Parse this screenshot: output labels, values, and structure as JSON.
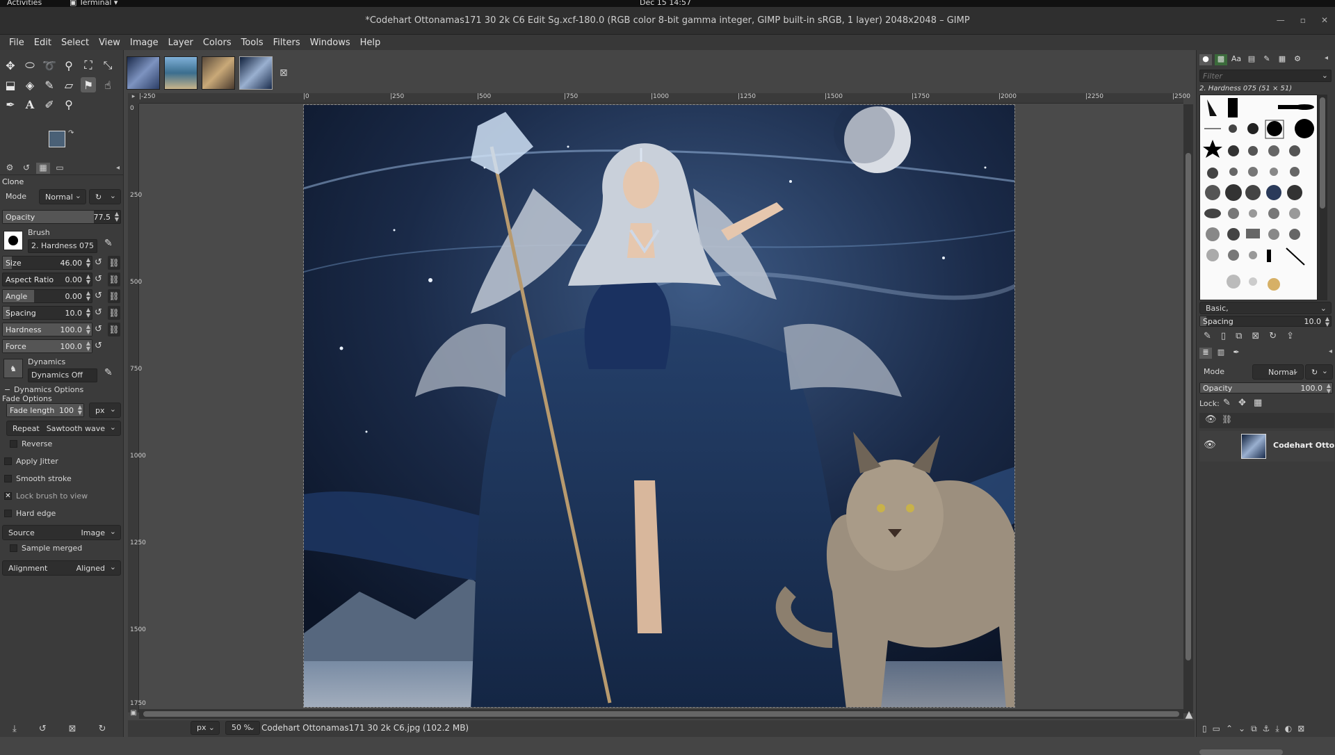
{
  "system": {
    "activities": "Activities",
    "app_menu": "Terminal",
    "clock": "Dec 15  14:57"
  },
  "window": {
    "title": "*Codehart Ottonamas171 30 2k C6 Edit Sg.xcf-180.0 (RGB color 8-bit gamma integer, GIMP built-in sRGB, 1 layer) 2048x2048 – GIMP"
  },
  "menu": [
    "File",
    "Edit",
    "Select",
    "View",
    "Image",
    "Layer",
    "Colors",
    "Tools",
    "Filters",
    "Windows",
    "Help"
  ],
  "colors": {
    "foreground": "#4a6076",
    "background": "#2d2d2d"
  },
  "tool_options": {
    "title": "Clone",
    "mode_label": "Mode",
    "mode_value": "Normal",
    "opacity_label": "Opacity",
    "opacity_value": "77.5",
    "brush_label": "Brush",
    "brush_value": "2. Hardness 075",
    "size_label": "Size",
    "size_value": "46.00",
    "aspect_label": "Aspect Ratio",
    "aspect_value": "0.00",
    "angle_label": "Angle",
    "angle_value": "0.00",
    "spacing_label": "Spacing",
    "spacing_value": "10.0",
    "hardness_label": "Hardness",
    "hardness_value": "100.0",
    "force_label": "Force",
    "force_value": "100.0",
    "dynamics_label": "Dynamics",
    "dynamics_value": "Dynamics Off",
    "dynamics_options": "Dynamics Options",
    "fade_options": "Fade Options",
    "fade_length_label": "Fade length",
    "fade_length_value": "100",
    "fade_unit": "px",
    "repeat_label": "Repeat",
    "repeat_value": "Sawtooth wave",
    "reverse": "Reverse",
    "apply_jitter": "Apply Jitter",
    "smooth_stroke": "Smooth stroke",
    "lock_brush": "Lock brush to view",
    "hard_edge": "Hard edge",
    "source_label": "Source",
    "source_value": "Image",
    "sample_merged": "Sample merged",
    "alignment_label": "Alignment",
    "alignment_value": "Aligned"
  },
  "ruler": {
    "h_ticks": [
      "|-250",
      "|0",
      "|250",
      "|500",
      "|750",
      "|1000",
      "|1250",
      "|1500",
      "|1750",
      "|2000",
      "|2250",
      "|2500"
    ],
    "v_ticks": [
      "0",
      "250",
      "500",
      "750",
      "1000",
      "1250",
      "1500",
      "1750"
    ]
  },
  "status": {
    "unit": "px",
    "zoom": "50 %",
    "message": "Codehart Ottonamas171 30 2k C6.jpg (102.2 MB)"
  },
  "brushes": {
    "filter_placeholder": "Filter",
    "current": "2. Hardness 075 (51 × 51)",
    "tag": "Basic,",
    "spacing_label": "Spacing",
    "spacing_value": "10.0"
  },
  "layers": {
    "mode_label": "Mode",
    "mode_value": "Normal",
    "opacity_label": "Opacity",
    "opacity_value": "100.0",
    "lock_label": "Lock:",
    "layer_name": "Codehart Ottor"
  }
}
